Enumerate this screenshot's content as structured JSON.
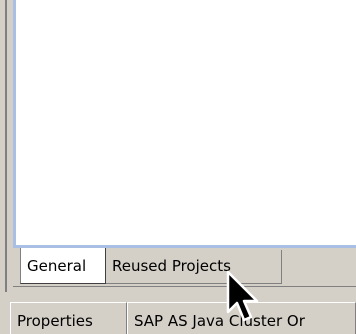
{
  "editor_tabs": [
    {
      "label": "General",
      "active": true
    },
    {
      "label": "Reused Projects",
      "active": false
    }
  ],
  "view_tabs": [
    {
      "label": "Properties"
    },
    {
      "label": "SAP AS Java Cluster Or"
    }
  ],
  "cursor": {
    "icon": "arrow-pointer-icon"
  }
}
